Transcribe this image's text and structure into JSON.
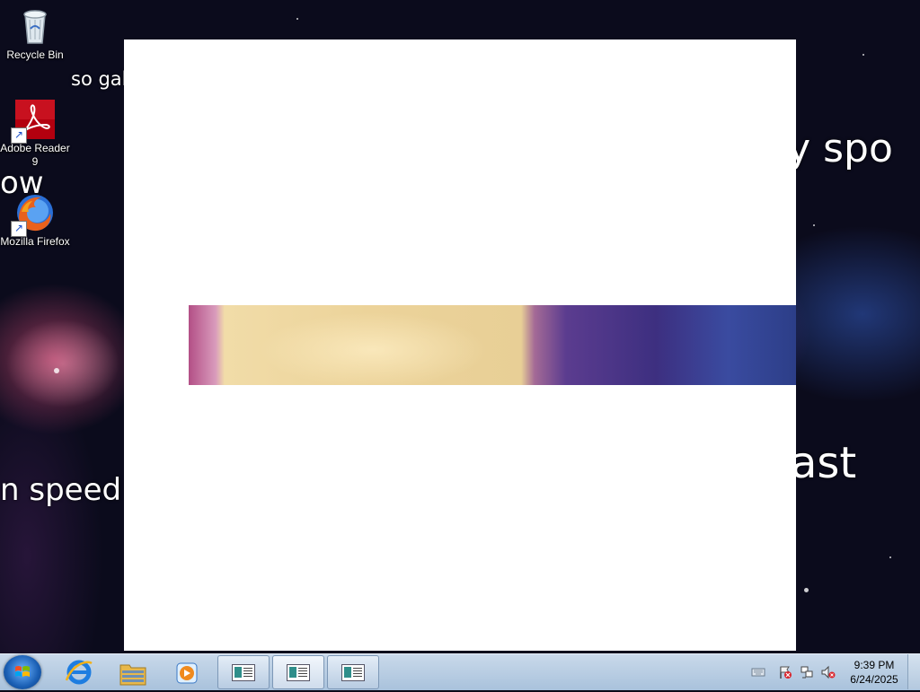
{
  "desktop": {
    "icons": [
      {
        "label": "Recycle Bin",
        "icon": "recycle-bin-icon"
      },
      {
        "label": "Adobe Reader 9",
        "icon": "adobe-reader-icon"
      },
      {
        "label": "Mozilla Firefox",
        "icon": "firefox-icon"
      }
    ],
    "wallpaper_text": {
      "top_left": "so gal",
      "left_mid": "ow",
      "left_low": "n speed",
      "right_top": "ry spo",
      "right_low": "ast"
    }
  },
  "taskbar": {
    "start_icon": "windows-start-icon",
    "pinned": [
      {
        "icon": "internet-explorer-icon"
      },
      {
        "icon": "windows-explorer-icon"
      },
      {
        "icon": "media-player-icon"
      }
    ],
    "tasks": [
      {
        "icon": "document-window-icon"
      },
      {
        "icon": "document-window-icon"
      },
      {
        "icon": "document-window-icon"
      }
    ],
    "tray": [
      {
        "icon": "keyboard-icon"
      },
      {
        "icon": "action-center-flag-icon"
      },
      {
        "icon": "network-icon"
      },
      {
        "icon": "volume-muted-icon"
      }
    ],
    "clock": {
      "time": "9:39 PM",
      "date": "6/24/2025"
    }
  },
  "colors": {
    "taskbar": "#a9c2dc",
    "window_background": "#ffffff"
  }
}
